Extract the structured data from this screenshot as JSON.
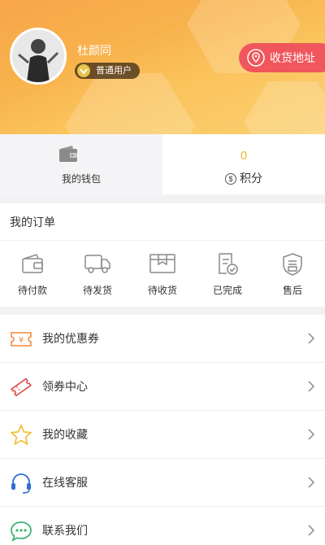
{
  "header": {
    "user_name": "杜颜同",
    "user_level": "普通用户",
    "address_button": "收货地址"
  },
  "stats": {
    "wallet_label": "我的钱包",
    "points_value": "0",
    "points_label": "积分",
    "points_icon": "$"
  },
  "orders": {
    "title": "我的订单",
    "items": [
      {
        "label": "待付款",
        "icon": "wallet-icon"
      },
      {
        "label": "待发货",
        "icon": "truck-icon"
      },
      {
        "label": "待收货",
        "icon": "box-icon"
      },
      {
        "label": "已完成",
        "icon": "completed-doc-icon"
      },
      {
        "label": "售后",
        "icon": "shield-icon"
      }
    ]
  },
  "menu": {
    "items": [
      {
        "label": "我的优惠券",
        "icon": "coupon-icon"
      },
      {
        "label": "领券中心",
        "icon": "ticket-icon"
      },
      {
        "label": "我的收藏",
        "icon": "star-icon"
      },
      {
        "label": "在线客服",
        "icon": "headset-icon"
      },
      {
        "label": "联系我们",
        "icon": "chat-icon"
      }
    ]
  },
  "colors": {
    "header_gradient_start": "#f7a64a",
    "header_gradient_end": "#fbd072",
    "address_button": "#f0565b",
    "points_value": "#f2b23c",
    "menu_icon_orange": "#f08a3c",
    "menu_icon_blue": "#2f6fd6",
    "menu_icon_green": "#3cb371",
    "menu_icon_yellow": "#f5c040"
  }
}
